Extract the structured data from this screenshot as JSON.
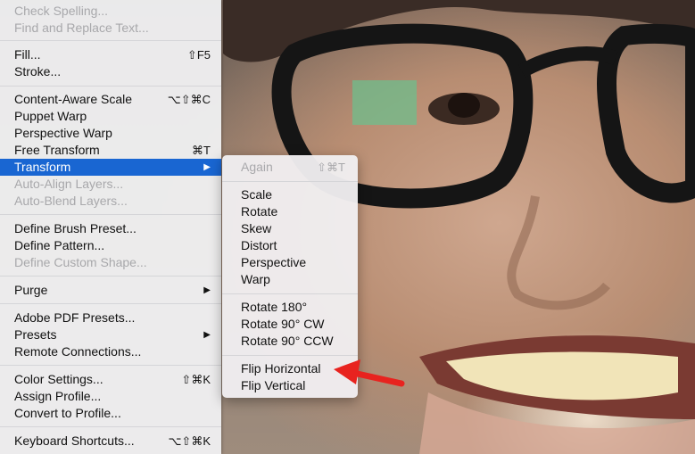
{
  "main_menu": {
    "items": [
      {
        "label": "Check Spelling...",
        "shortcut": "",
        "disabled": true
      },
      {
        "label": "Find and Replace Text...",
        "shortcut": "",
        "disabled": true
      },
      {
        "label": "Fill...",
        "shortcut": "⇧F5",
        "disabled": false
      },
      {
        "label": "Stroke...",
        "shortcut": "",
        "disabled": false
      },
      {
        "label": "Content-Aware Scale",
        "shortcut": "⌥⇧⌘C",
        "disabled": false
      },
      {
        "label": "Puppet Warp",
        "shortcut": "",
        "disabled": false
      },
      {
        "label": "Perspective Warp",
        "shortcut": "",
        "disabled": false
      },
      {
        "label": "Free Transform",
        "shortcut": "⌘T",
        "disabled": false
      },
      {
        "label": "Transform",
        "shortcut": "",
        "disabled": false,
        "selected": true,
        "submenu": true
      },
      {
        "label": "Auto-Align Layers...",
        "shortcut": "",
        "disabled": true
      },
      {
        "label": "Auto-Blend Layers...",
        "shortcut": "",
        "disabled": true
      },
      {
        "label": "Define Brush Preset...",
        "shortcut": "",
        "disabled": false
      },
      {
        "label": "Define Pattern...",
        "shortcut": "",
        "disabled": false
      },
      {
        "label": "Define Custom Shape...",
        "shortcut": "",
        "disabled": true
      },
      {
        "label": "Purge",
        "shortcut": "",
        "disabled": false,
        "submenu": true
      },
      {
        "label": "Adobe PDF Presets...",
        "shortcut": "",
        "disabled": false
      },
      {
        "label": "Presets",
        "shortcut": "",
        "disabled": false,
        "submenu": true
      },
      {
        "label": "Remote Connections...",
        "shortcut": "",
        "disabled": false
      },
      {
        "label": "Color Settings...",
        "shortcut": "⇧⌘K",
        "disabled": false
      },
      {
        "label": "Assign Profile...",
        "shortcut": "",
        "disabled": false
      },
      {
        "label": "Convert to Profile...",
        "shortcut": "",
        "disabled": false
      },
      {
        "label": "Keyboard Shortcuts...",
        "shortcut": "⌥⇧⌘K",
        "disabled": false
      }
    ],
    "submenu_arrow": "▶"
  },
  "transform_submenu": {
    "items": [
      {
        "label": "Again",
        "shortcut": "⇧⌘T",
        "disabled": true
      },
      {
        "label": "Scale",
        "shortcut": "",
        "disabled": false
      },
      {
        "label": "Rotate",
        "shortcut": "",
        "disabled": false
      },
      {
        "label": "Skew",
        "shortcut": "",
        "disabled": false
      },
      {
        "label": "Distort",
        "shortcut": "",
        "disabled": false
      },
      {
        "label": "Perspective",
        "shortcut": "",
        "disabled": false
      },
      {
        "label": "Warp",
        "shortcut": "",
        "disabled": false
      },
      {
        "label": "Rotate 180°",
        "shortcut": "",
        "disabled": false
      },
      {
        "label": "Rotate 90° CW",
        "shortcut": "",
        "disabled": false
      },
      {
        "label": "Rotate 90° CCW",
        "shortcut": "",
        "disabled": false
      },
      {
        "label": "Flip Horizontal",
        "shortcut": "",
        "disabled": false
      },
      {
        "label": "Flip Vertical",
        "shortcut": "",
        "disabled": false
      }
    ]
  },
  "colors": {
    "selection": "#1966d2",
    "annotation_arrow": "#e8231f"
  }
}
